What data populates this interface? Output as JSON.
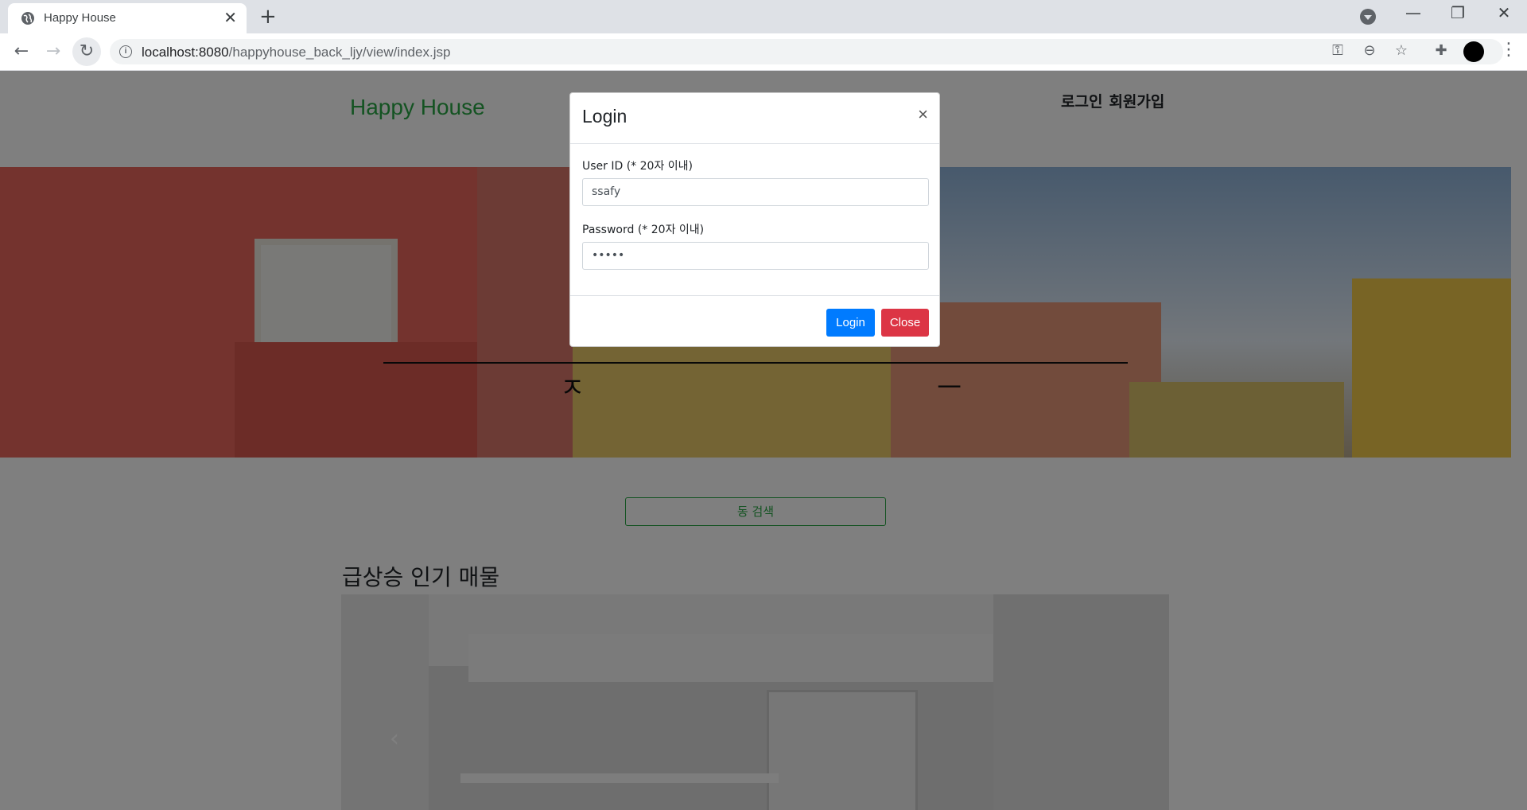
{
  "browser": {
    "tab_title": "Happy House",
    "tab_close": "✕",
    "new_tab": "+",
    "url_host": "localhost:8080",
    "url_path": "/happyhouse_back_ljy/view/index.jsp"
  },
  "site": {
    "brand": "Happy House",
    "login_link": "로그인",
    "signup_link": "회원가입",
    "search_button": "동 검색",
    "section_title": "급상승 인기 매물"
  },
  "modal": {
    "title": "Login",
    "close_symbol": "×",
    "userid_label": "User ID (* 20자 이내)",
    "userid_value": "ssafy",
    "password_label": "Password (* 20자 이내)",
    "password_value": "•••••",
    "login_button": "Login",
    "close_button": "Close"
  },
  "colors": {
    "brand_green": "#28a745",
    "primary": "#007bff",
    "danger": "#dc3545"
  }
}
